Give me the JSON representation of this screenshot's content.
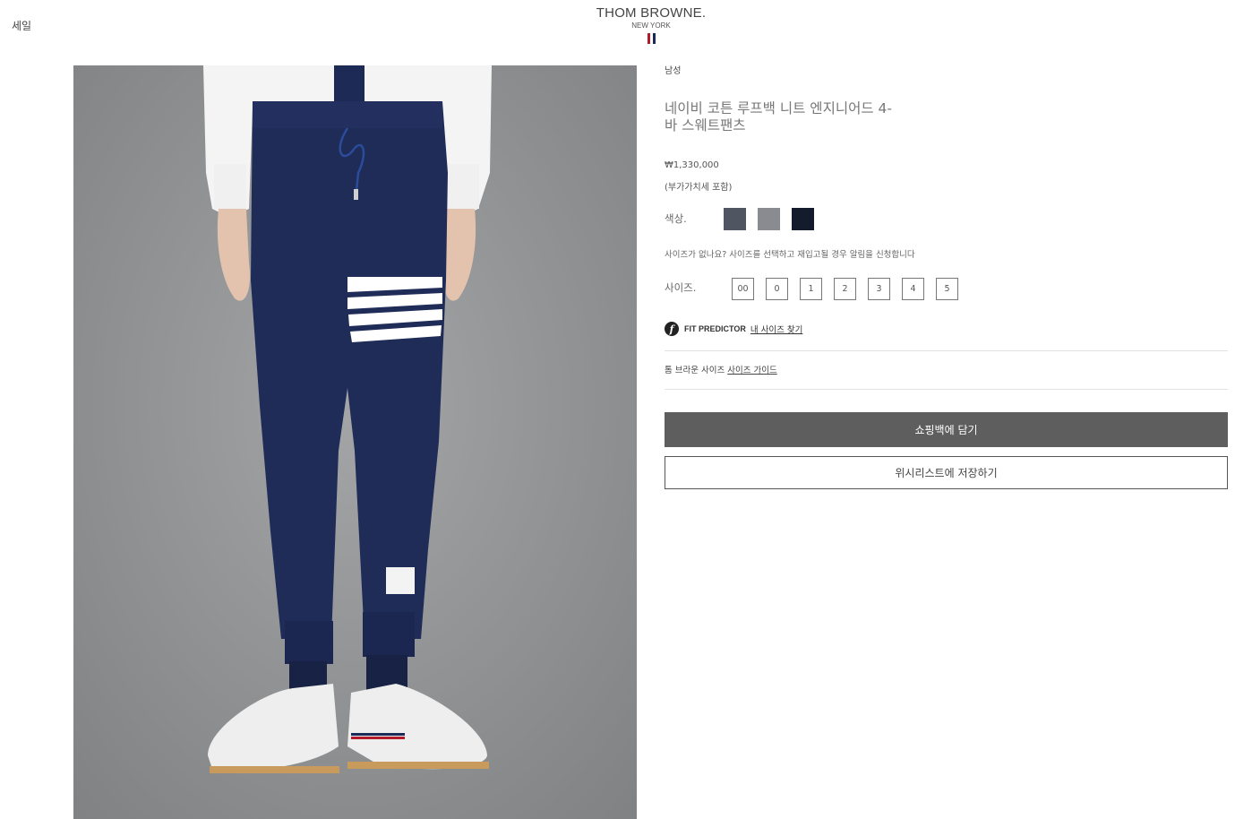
{
  "header": {
    "sale_label": "세일",
    "brand_name": "THOM BROWNE.",
    "brand_sub": "NEW YORK",
    "flag_colors": [
      "#b31b2c",
      "#ffffff",
      "#1c2a5a"
    ]
  },
  "product": {
    "gender": "남성",
    "title": "네이비 코튼 루프백 니트 엔지니어드 4-바 스웨트팬츠",
    "price": "₩1,330,000",
    "vat_note": "(부가가치세 포함)",
    "image_alt": "navy sweatpants product photo"
  },
  "color": {
    "label": "색상.",
    "swatches": [
      "#4f5661",
      "#8a8a91",
      "#141b2d"
    ]
  },
  "size": {
    "notice": "사이즈가 없나요? 사이즈를 선택하고 재입고될 경우 알림을 신청합니다",
    "label": "사이즈.",
    "options": [
      "00",
      "0",
      "1",
      "2",
      "3",
      "4",
      "5"
    ]
  },
  "fit_predictor": {
    "brand": "FIT PREDICTOR",
    "link": "내 사이즈 찾기"
  },
  "size_guide": {
    "prefix": "톰 브라운 사이즈",
    "link": "사이즈 가이드"
  },
  "actions": {
    "add_to_bag": "쇼핑백에 담기",
    "wishlist": "위시리스트에 저장하기"
  },
  "colors": {
    "primary_button": "#5e5e5e",
    "pants_navy": "#1f2c58",
    "background_gray": "#8d8f91"
  }
}
